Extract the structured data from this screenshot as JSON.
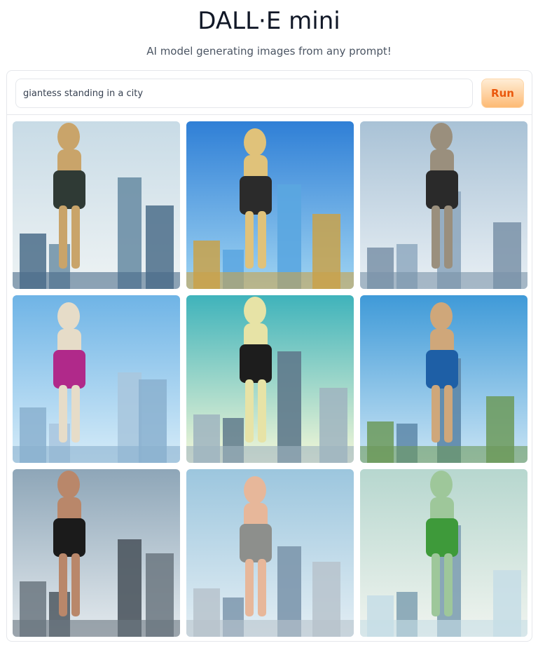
{
  "header": {
    "title": "DALL·E mini",
    "subtitle": "AI model generating images from any prompt!"
  },
  "prompt": {
    "value": "giantess standing in a city",
    "placeholder": ""
  },
  "run_button": {
    "label": "Run"
  },
  "colors": {
    "accent": "#ea580c",
    "button_bg": "#fdba74",
    "border": "#e5e7eb"
  },
  "results": [
    {
      "sky": "#c8dbe6",
      "sky2": "#eef3f4",
      "figure": "#c9a46a",
      "outfit": "#2f3a35",
      "build": "#6d8fa6",
      "build2": "#4b6d8a"
    },
    {
      "sky": "#2f7fd6",
      "sky2": "#9fd4f2",
      "figure": "#e0c27a",
      "outfit": "#2b2b2b",
      "build": "#5aa6e0",
      "build2": "#c9a24a"
    },
    {
      "sky": "#a9c2d6",
      "sky2": "#e8eff4",
      "figure": "#9a8f7d",
      "outfit": "#2a2a2a",
      "build": "#8fa9bf",
      "build2": "#7a92a8"
    },
    {
      "sky": "#6fb4e6",
      "sky2": "#d6ecf8",
      "figure": "#e6dcc8",
      "outfit": "#b0298a",
      "build": "#a9c6de",
      "build2": "#8ab0cf"
    },
    {
      "sky": "#3fb3bb",
      "sky2": "#f4f7d7",
      "figure": "#e7e3a6",
      "outfit": "#1d1d1d",
      "build": "#5f7a8c",
      "build2": "#9fb4c0"
    },
    {
      "sky": "#3f9ad8",
      "sky2": "#c9e4f4",
      "figure": "#cfa77a",
      "outfit": "#1e5fa6",
      "build": "#5d87a8",
      "build2": "#6c9a5a"
    },
    {
      "sky": "#8ea6b8",
      "sky2": "#e4eaee",
      "figure": "#b9876a",
      "outfit": "#1b1b1b",
      "build": "#4e5860",
      "build2": "#6b7780"
    },
    {
      "sky": "#9cc6de",
      "sky2": "#e3eef4",
      "figure": "#e7b79a",
      "outfit": "#8d8f8c",
      "build": "#7d97ad",
      "build2": "#b7c3cc"
    },
    {
      "sky": "#b7d7cf",
      "sky2": "#f0f4ef",
      "figure": "#9ec79a",
      "outfit": "#3e9a3a",
      "build": "#7fa0b2",
      "build2": "#c6dde6"
    }
  ]
}
